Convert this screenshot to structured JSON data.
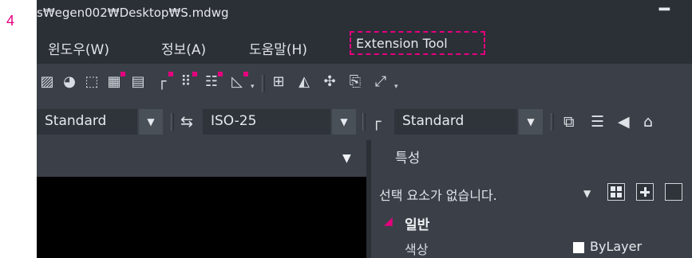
{
  "step_number": "4",
  "window": {
    "title": "s₩egen002₩Desktop₩S.mdwg",
    "minimize_glyph": "━"
  },
  "menu": {
    "items": [
      "윈도우(W)",
      "정보(A)",
      "도움말(H)",
      "Extension Tool"
    ],
    "highlight_color": "#e6007e"
  },
  "toolbar": {
    "icons": [
      "hatch-icon",
      "region-icon",
      "boundary-icon",
      "block-info-icon",
      "attribute-icon",
      "leader-icon",
      "array-icon",
      "table-icon",
      "dimension-icon",
      "paste-block-icon",
      "copy-block-icon",
      "move-block-icon",
      "insert-block-icon",
      "edit-block-icon"
    ]
  },
  "styles": {
    "text_style": "Standard",
    "dim_style": "ISO-25",
    "multileader_style": "Standard"
  },
  "properties": {
    "title": "특성",
    "selection": "선택 요소가 없습니다.",
    "section": "일반",
    "rows": [
      {
        "name": "색상",
        "value": "ByLayer",
        "swatch": "#ffffff"
      }
    ]
  }
}
